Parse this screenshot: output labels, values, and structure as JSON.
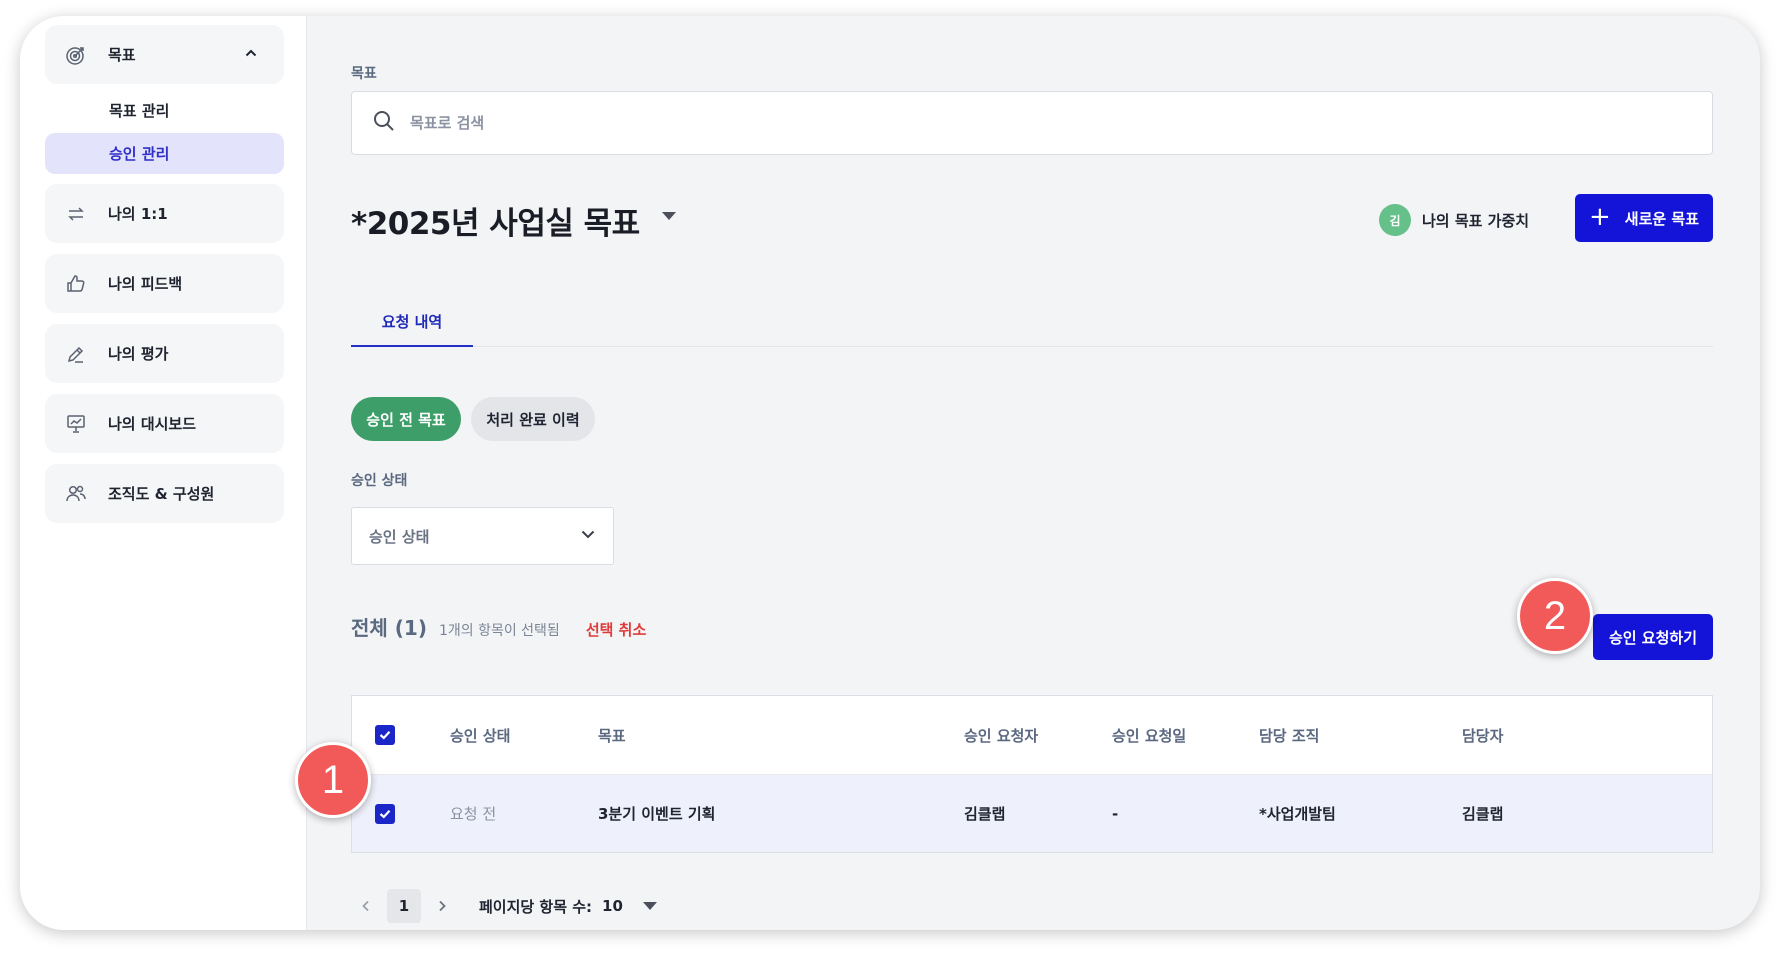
{
  "sidebar": {
    "goal_group": {
      "label": "목표",
      "expanded": true
    },
    "sub_items": [
      {
        "label": "목표 관리",
        "active": false
      },
      {
        "label": "승인 관리",
        "active": true
      }
    ],
    "items": [
      {
        "label": "나의 1:1",
        "icon": "swap-arrows-icon"
      },
      {
        "label": "나의 피드백",
        "icon": "thumbs-up-icon"
      },
      {
        "label": "나의 평가",
        "icon": "pen-icon"
      },
      {
        "label": "나의 대시보드",
        "icon": "presentation-board-icon"
      },
      {
        "label": "조직도 & 구성원",
        "icon": "users-icon"
      }
    ]
  },
  "main": {
    "search_label": "목표",
    "search_placeholder": "목표로 검색",
    "page_title": "*2025년 사업실 목표",
    "weight": {
      "avatar_initial": "김",
      "label": "나의 목표 가중치"
    },
    "new_goal_button": {
      "plus": "+",
      "label": "새로운 목표"
    },
    "tab": "요청 내역",
    "chips": [
      {
        "label": "승인 전 목표",
        "active": true
      },
      {
        "label": "처리 완료 이력",
        "active": false
      }
    ],
    "status_filter": {
      "label": "승인 상태",
      "value": "승인 상태"
    },
    "count": {
      "total": "전체 (1)",
      "selected": "1개의 항목이 선택됨",
      "cancel": "선택 취소"
    },
    "request_button": "승인 요청하기",
    "table": {
      "headers": [
        "승인 상태",
        "목표",
        "승인 요청자",
        "승인 요청일",
        "담당 조직",
        "담당자"
      ],
      "rows": [
        {
          "checked": true,
          "status": "요청 전",
          "goal": "3분기 이벤트 기획",
          "requester": "김클랩",
          "request_date": "-",
          "org": "*사업개발팀",
          "owner": "김클랩"
        }
      ]
    },
    "pagination": {
      "current_page": "1",
      "per_page_label": "페이지당 항목 수:",
      "per_page_value": "10"
    }
  },
  "annotations": {
    "marker_1": "1",
    "marker_2": "2"
  },
  "colors": {
    "primary": "#1414d8",
    "active_chip": "#3e9e6a",
    "cancel": "#e03b3b",
    "marker": "#f15a59",
    "active_nav_bg": "#e3e4fb"
  }
}
